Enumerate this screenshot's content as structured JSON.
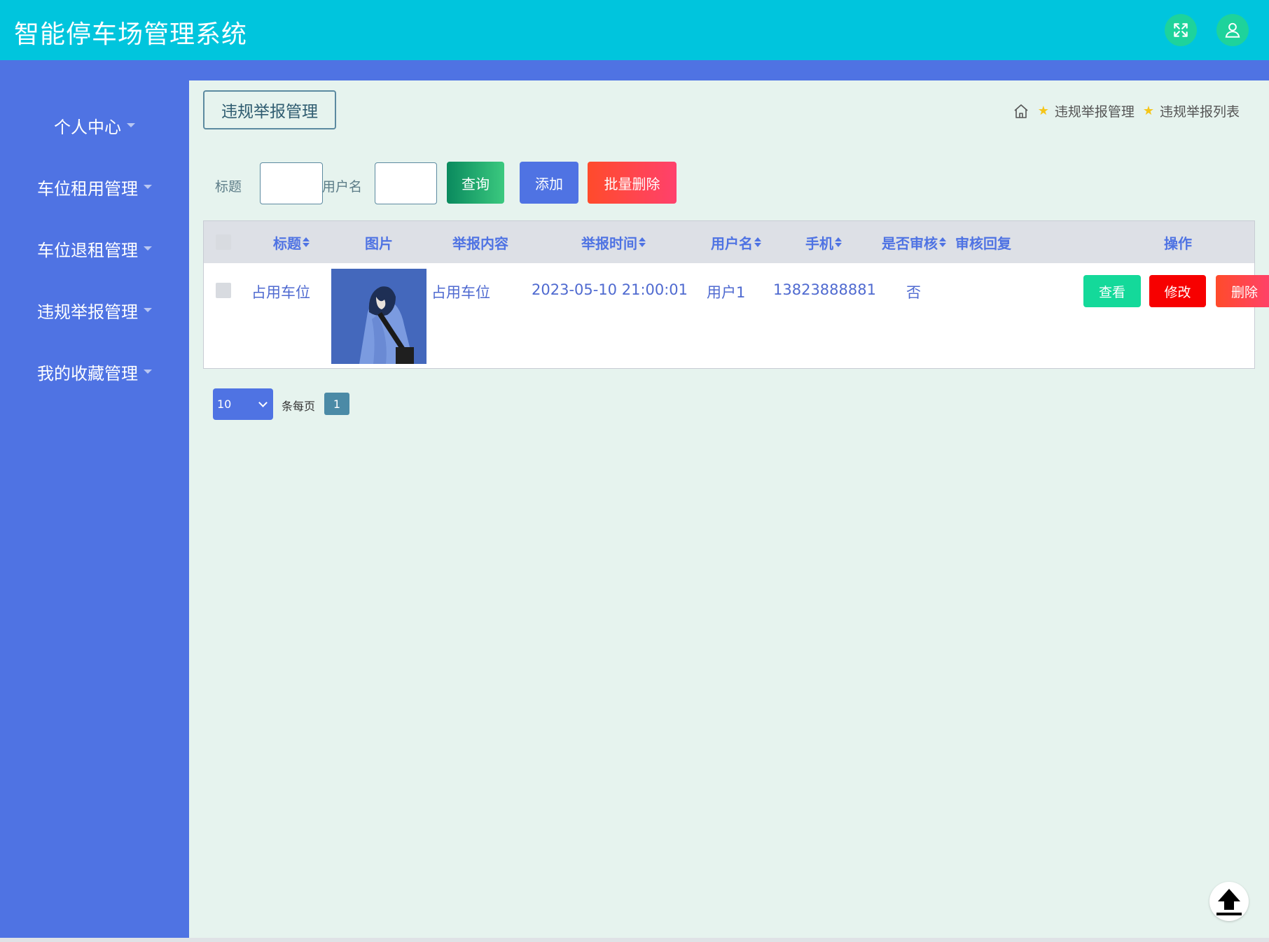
{
  "app": {
    "title": "智能停车场管理系统"
  },
  "header": {
    "icons": {
      "fullscreen": "fullscreen-icon",
      "user": "user-icon"
    },
    "colors": {
      "bar": "#00c5dd",
      "icon_bg": "#1ed39b"
    }
  },
  "sidebar": {
    "items": [
      {
        "label": "个人中心"
      },
      {
        "label": "车位租用管理"
      },
      {
        "label": "车位退租管理"
      },
      {
        "label": "违规举报管理"
      },
      {
        "label": "我的收藏管理"
      }
    ]
  },
  "page": {
    "title": "违规举报管理",
    "breadcrumb": [
      "违规举报管理",
      "违规举报列表"
    ]
  },
  "search": {
    "title_label": "标题",
    "title_value": "",
    "username_label": "用户名",
    "username_value": "",
    "query_label": "查询",
    "add_label": "添加",
    "batch_delete_label": "批量删除"
  },
  "table": {
    "columns": [
      "标题",
      "图片",
      "举报内容",
      "举报时间",
      "用户名",
      "手机",
      "是否审核",
      "审核回复",
      "操作"
    ],
    "rows": [
      {
        "title": "占用车位",
        "content": "占用车位",
        "time": "2023-05-10 21:00:01",
        "username": "用户1",
        "phone": "13823888881",
        "reviewed": "否",
        "reply": "",
        "actions": {
          "view": "查看",
          "edit": "修改",
          "delete": "删除"
        }
      }
    ]
  },
  "pagination": {
    "page_size": "10",
    "per_page_label": "条每页",
    "current_page": "1"
  }
}
